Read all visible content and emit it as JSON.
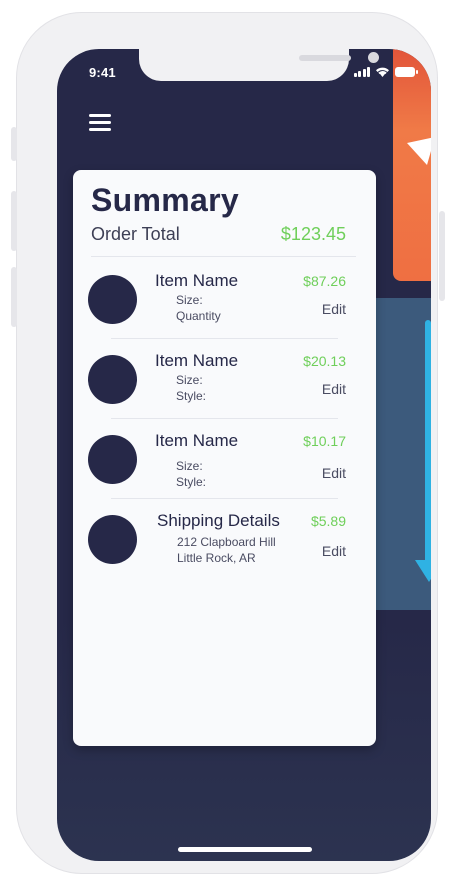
{
  "status_bar": {
    "time": "9:41"
  },
  "summary": {
    "title": "Summary",
    "order_total_label": "Order Total",
    "order_total_value": "$123.45"
  },
  "items": [
    {
      "name": "Item Name",
      "price": "$87.26",
      "line1": "Size:",
      "line2": "Quantity",
      "edit_label": "Edit"
    },
    {
      "name": "Item Name",
      "price": "$20.13",
      "line1": "Size:",
      "line2": "Style:",
      "edit_label": "Edit"
    },
    {
      "name": "Item Name",
      "price": "$10.17",
      "line1": "Size:",
      "line2": "Style:",
      "edit_label": "Edit"
    }
  ],
  "shipping": {
    "name": "Shipping Details",
    "price": "$5.89",
    "line1": "212 Clapboard Hill",
    "line2": "Little Rock, AR",
    "edit_label": "Edit"
  },
  "colors": {
    "navy": "#262848",
    "accent_green": "#6fcf5a",
    "orange": "#f07a47",
    "blue_card": "#3c5a7c",
    "arrow_blue": "#2fb2e3"
  },
  "icons": [
    "menu-icon",
    "signal-icon",
    "wifi-icon",
    "battery-icon",
    "arrow-down-icon",
    "send-icon"
  ]
}
